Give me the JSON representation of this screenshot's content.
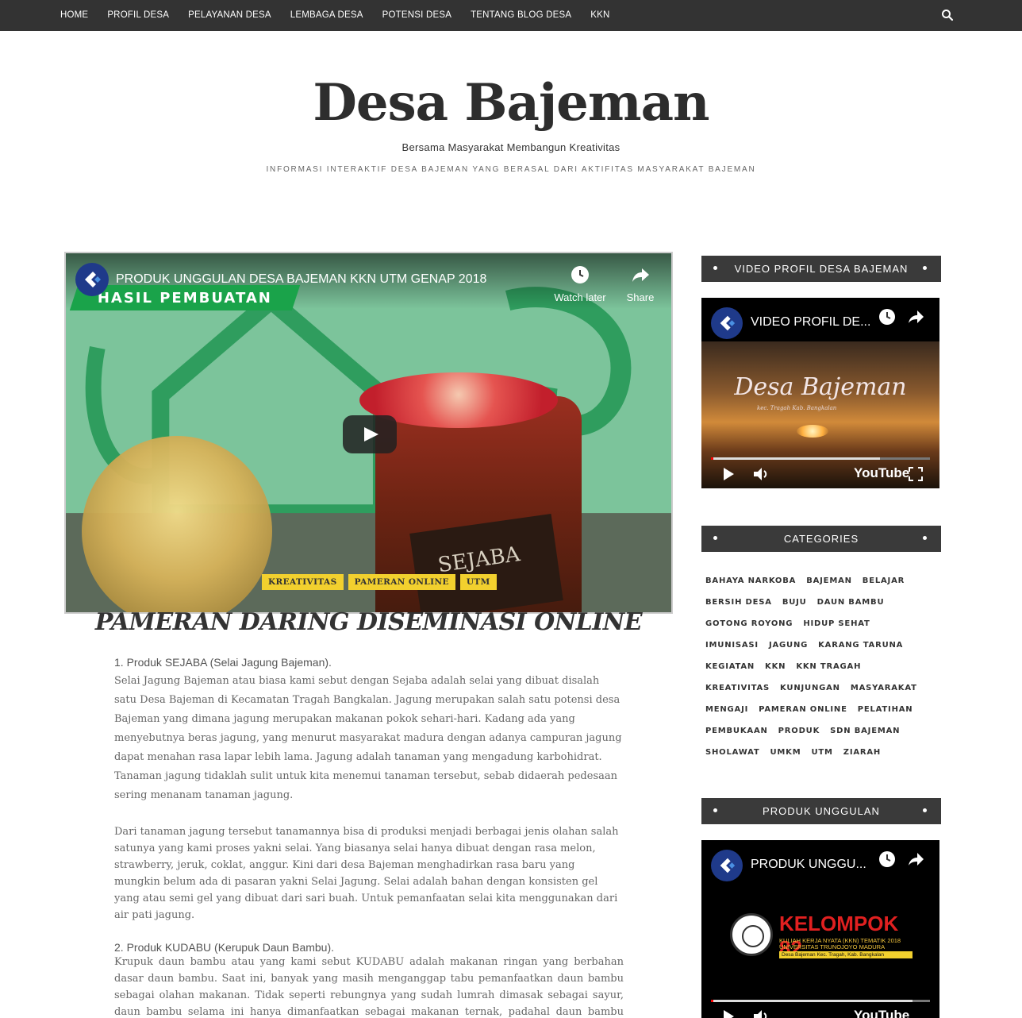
{
  "nav": {
    "items": [
      "HOME",
      "PROFIL DESA",
      "PELAYANAN DESA",
      "LEMBAGA DESA",
      "POTENSI DESA",
      "TENTANG BLOG DESA",
      "KKN"
    ],
    "search_icon": "search-icon"
  },
  "header": {
    "title": "Desa Bajeman",
    "tagline": "Bersama Masyarakat Membangun Kreativitas",
    "description": "INFORMASI INTERAKTIF DESA BAJEMAN YANG BERASAL DARI AKTIFITAS MASYARAKAT BAJEMAN"
  },
  "main_video": {
    "title": "PRODUK UNGGULAN DESA BAJEMAN KKN UTM GENAP 2018",
    "banner": "HASIL PEMBUATAN",
    "watch_later": "Watch later",
    "share": "Share",
    "jar_label": "SEJABA"
  },
  "post": {
    "tags": [
      "KREATIVITAS",
      "PAMERAN ONLINE",
      "UTM"
    ],
    "title": "PAMERAN DARING DISEMINASI ONLINE",
    "heading1": "1. Produk SEJABA (Selai Jagung Bajeman).",
    "para1": "Selai Jagung Bajeman atau biasa kami sebut dengan Sejaba adalah selai yang dibuat disalah satu Desa Bajeman di Kecamatan Tragah Bangkalan. Jagung merupakan salah satu potensi desa Bajeman yang dimana jagung merupakan makanan pokok sehari-hari. Kadang ada yang menyebutnya beras jagung, yang menurut masyarakat madura dengan adanya campuran jagung dapat menahan rasa lapar lebih lama. Jagung adalah tanaman yang mengadung karbohidrat. Tanaman jagung tidaklah sulit untuk kita menemui tanaman tersebut, sebab didaerah pedesaan sering menanam tanaman jagung.",
    "para2": "Dari tanaman jagung tersebut tanamannya bisa di produksi menjadi berbagai jenis olahan salah satunya yang kami proses yakni selai. Yang biasanya selai hanya dibuat dengan rasa melon, strawberry, jeruk, coklat, anggur. Kini dari desa Bajeman menghadirkan rasa baru yang mungkin belum  ada di pasaran yakni Selai Jagung. Selai adalah bahan dengan konsisten gel yang atau semi gel yang dibuat dari sari buah. Untuk pemanfaatan selai kita menggunakan dari air pati jagung.",
    "heading2": "2. Produk KUDABU (Kerupuk Daun Bambu).",
    "para3": "Krupuk daun bambu atau yang kami sebut KUDABU adalah makanan ringan yang berbahan dasar daun bambu. Saat ini, banyak yang masih menganggap tabu pemanfaatkan daun bambu sebagai olahan makanan. Tidak seperti rebungnya yang sudah lumrah dimasak sebagai sayur, daun bambu selama ini hanya dimanfaatkan sebagai makanan ternak, padahal daun bambu memiliki banyak kandungan yang bermanfaat bagi kesehatan. Bahkan, di China dan Amerika sudah lama menjadikan daun bambu menjadi teh."
  },
  "sidebar": {
    "video_profile": {
      "widget_title": "VIDEO PROFIL DESA BAJEMAN",
      "video_title": "VIDEO PROFIL DE...",
      "brand": "Desa Bajeman",
      "brand_sub": "kec. Tragah Kab. Bangkalan",
      "youtube": "YouTube",
      "progress_loaded": 0.77
    },
    "categories": {
      "widget_title": "CATEGORIES",
      "items": [
        "BAHAYA NARKOBA",
        "BAJEMAN",
        "BELAJAR",
        "BERSIH DESA",
        "BUJU",
        "DAUN BAMBU",
        "GOTONG ROYONG",
        "HIDUP SEHAT",
        "IMUNISASI",
        "JAGUNG",
        "KARANG TARUNA",
        "KEGIATAN",
        "KKN",
        "KKN TRAGAH",
        "KREATIVITAS",
        "KUNJUNGAN",
        "MASYARAKAT",
        "MENGAJI",
        "PAMERAN ONLINE",
        "PELATIHAN",
        "PEMBUKAAN",
        "PRODUK",
        "SDN BAJEMAN",
        "SHOLAWAT",
        "UMKM",
        "UTM",
        "ZIARAH"
      ]
    },
    "produk": {
      "widget_title": "PRODUK UNGGULAN",
      "video_title": "PRODUK UNGGU...",
      "kelompok": "KELOMPOK 82",
      "line1": "KULIAH KERJA NYATA (KKN) TEMATIK 2018",
      "line2": "UNIVERSITAS TRUNOJOYO MADURA",
      "line3": "Desa Bajeman  Kec. Tragah, Kab. Bangkalan",
      "youtube": "YouTube",
      "progress_loaded": 0.92
    }
  },
  "colors": {
    "nav_bg": "#333333",
    "widget_bg": "#3a3a3a",
    "tag_bg": "#f2d02e"
  }
}
